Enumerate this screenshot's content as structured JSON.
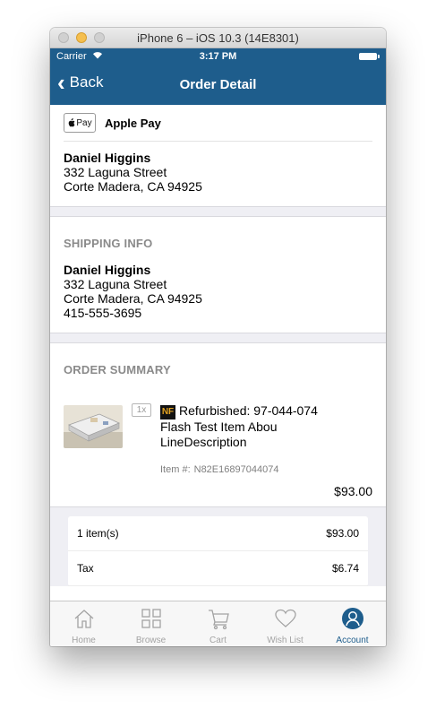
{
  "window": {
    "title": "iPhone 6 – iOS 10.3 (14E8301)"
  },
  "status_bar": {
    "carrier": "Carrier",
    "time": "3:17 PM"
  },
  "nav": {
    "back_label": "Back",
    "title": "Order Detail"
  },
  "payment": {
    "badge": "Pay",
    "method": "Apple Pay"
  },
  "billing": {
    "name": "Daniel Higgins",
    "street": "332 Laguna Street",
    "city": "Corte Madera, CA 94925"
  },
  "shipping": {
    "title": "SHIPPING INFO",
    "name": "Daniel Higgins",
    "street": "332 Laguna Street",
    "city": "Corte Madera, CA 94925",
    "phone": "415-555-3695"
  },
  "summary": {
    "title": "ORDER SUMMARY",
    "item": {
      "qty": "1x",
      "logo": "NF",
      "title": "Refurbished: 97-044-074 Flash Test Item Abou LineDescription",
      "number_label": "Item #:",
      "number": "N82E16897044074",
      "price": "$93.00"
    }
  },
  "totals": [
    {
      "label": "1 item(s)",
      "value": "$93.00"
    },
    {
      "label": "Tax",
      "value": "$6.74"
    }
  ],
  "tabs": [
    {
      "label": "Home",
      "icon": "home-icon"
    },
    {
      "label": "Browse",
      "icon": "grid-icon"
    },
    {
      "label": "Cart",
      "icon": "cart-icon"
    },
    {
      "label": "Wish List",
      "icon": "heart-icon"
    },
    {
      "label": "Account",
      "icon": "account-icon",
      "active": true
    }
  ],
  "colors": {
    "accent": "#1e5d8c",
    "tab_inactive": "#a3a3a3",
    "section_bg": "#efeff4"
  }
}
